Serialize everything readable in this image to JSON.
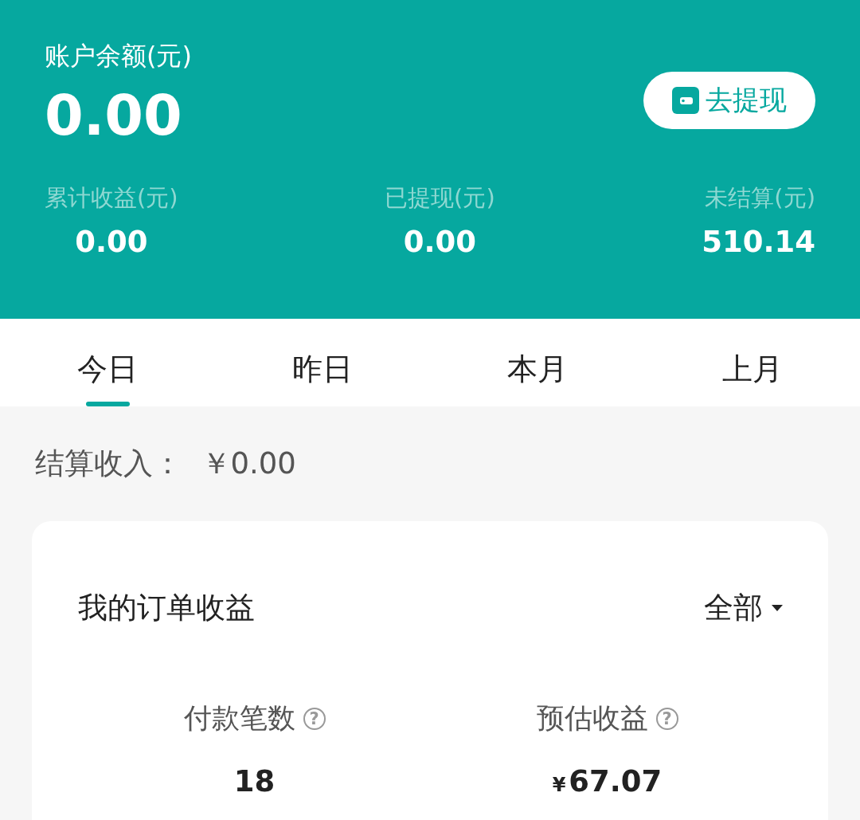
{
  "balance": {
    "label": "账户余额(元)",
    "amount": "0.00"
  },
  "withdraw_button": {
    "label": "去提现"
  },
  "summary": [
    {
      "label": "累计收益(元)",
      "value": "0.00"
    },
    {
      "label": "已提现(元)",
      "value": "0.00"
    },
    {
      "label": "未结算(元)",
      "value": "510.14"
    }
  ],
  "tabs": [
    {
      "label": "今日",
      "selected": true
    },
    {
      "label": "昨日",
      "selected": false
    },
    {
      "label": "本月",
      "selected": false
    },
    {
      "label": "上月",
      "selected": false
    }
  ],
  "settled_income": {
    "label": "结算收入：",
    "currency": "￥",
    "amount": "0.00"
  },
  "order_card": {
    "title": "我的订单收益",
    "filter": "全部",
    "metrics": [
      {
        "label": "付款笔数",
        "help": "?",
        "value": "18"
      },
      {
        "label": "预估收益",
        "help": "?",
        "currency": "¥",
        "value": "67.07"
      }
    ]
  }
}
